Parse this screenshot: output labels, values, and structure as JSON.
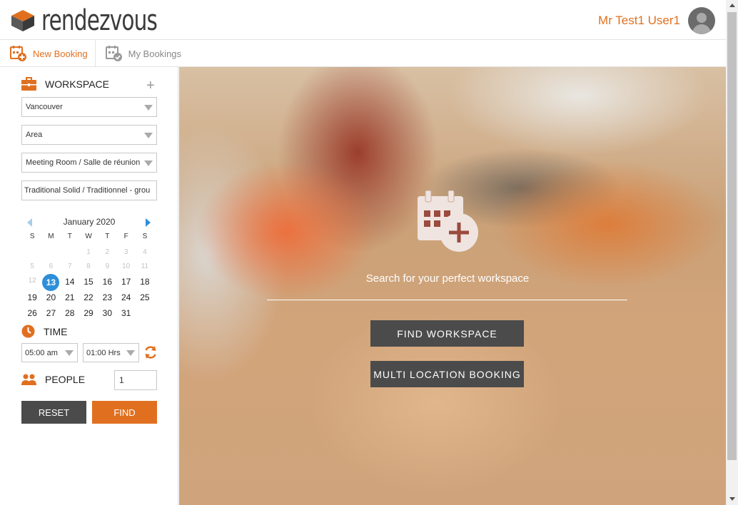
{
  "header": {
    "logo_text": "rendezvous",
    "user_name": "Mr Test1 User1"
  },
  "tabs": [
    {
      "label": "New Booking",
      "icon": "calendar-plus-icon",
      "active": true
    },
    {
      "label": "My Bookings",
      "icon": "calendar-check-icon",
      "active": false
    }
  ],
  "sidebar": {
    "workspace_label": "WORKSPACE",
    "location": "Vancouver",
    "area": "Area",
    "room_type": "Meeting Room / Salle de réunion",
    "furniture": "Traditional Solid / Traditionnel - grou",
    "calendar": {
      "title": "January 2020",
      "weekdays": [
        "S",
        "M",
        "T",
        "W",
        "T",
        "F",
        "S"
      ],
      "days": [
        {
          "d": "",
          "m": true
        },
        {
          "d": "",
          "m": true
        },
        {
          "d": "",
          "m": true
        },
        {
          "d": "1",
          "m": true
        },
        {
          "d": "2",
          "m": true
        },
        {
          "d": "3",
          "m": true
        },
        {
          "d": "4",
          "m": true
        },
        {
          "d": "5",
          "m": true
        },
        {
          "d": "6",
          "m": true
        },
        {
          "d": "7",
          "m": true
        },
        {
          "d": "8",
          "m": true
        },
        {
          "d": "9",
          "m": true
        },
        {
          "d": "10",
          "m": true
        },
        {
          "d": "11",
          "m": true
        },
        {
          "d": "12",
          "m": true
        },
        {
          "d": "13",
          "today": true
        },
        {
          "d": "14"
        },
        {
          "d": "15"
        },
        {
          "d": "16"
        },
        {
          "d": "17"
        },
        {
          "d": "18"
        },
        {
          "d": "19"
        },
        {
          "d": "20"
        },
        {
          "d": "21"
        },
        {
          "d": "22"
        },
        {
          "d": "23"
        },
        {
          "d": "24"
        },
        {
          "d": "25"
        },
        {
          "d": "26"
        },
        {
          "d": "27"
        },
        {
          "d": "28"
        },
        {
          "d": "29"
        },
        {
          "d": "30"
        },
        {
          "d": "31"
        }
      ]
    },
    "time_label": "TIME",
    "start_time": "05:00 am",
    "duration": "01:00 Hrs",
    "people_label": "PEOPLE",
    "people_value": "1",
    "reset_label": "RESET",
    "find_label": "FIND"
  },
  "hero": {
    "tagline": "Search for your perfect workspace",
    "find_workspace_label": "FIND WORKSPACE",
    "multi_location_label": "MULTI LOCATION BOOKING"
  },
  "colors": {
    "accent": "#e07020",
    "dark_button": "#4b4b4b",
    "today": "#2e8fd9"
  }
}
